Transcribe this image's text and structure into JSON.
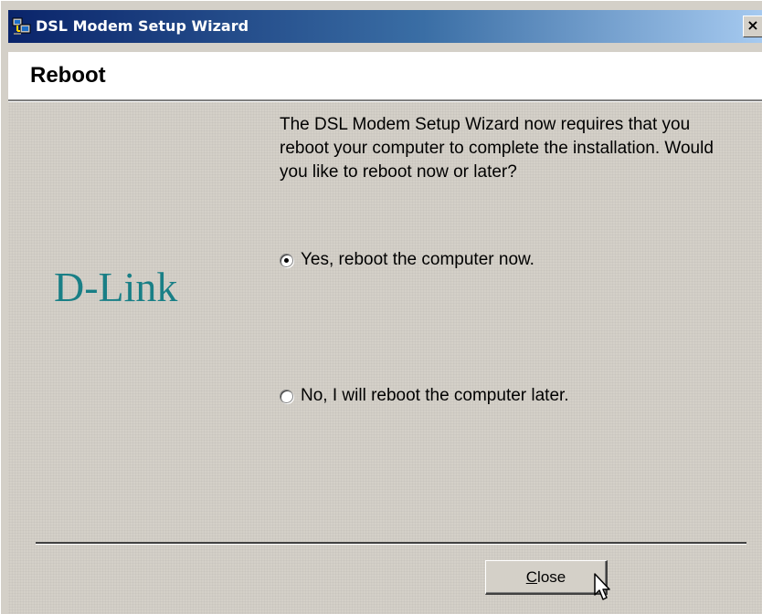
{
  "window": {
    "title": "DSL Modem Setup Wizard",
    "close_glyph": "×"
  },
  "header": {
    "title": "Reboot"
  },
  "brand": {
    "logo_text": "D-Link",
    "logo_color": "#197f86"
  },
  "body": {
    "message": "The DSL Modem Setup Wizard now requires that you reboot your computer to complete the installation.  Would you like to reboot now or later?"
  },
  "options": [
    {
      "label": "Yes, reboot the computer now.",
      "checked": true
    },
    {
      "label": "No, I will reboot the computer later.",
      "checked": false
    }
  ],
  "footer": {
    "close_button": {
      "mnemonic": "C",
      "rest": "lose"
    }
  },
  "icons": {
    "title_icon": "network-computer-icon",
    "cursor": "mouse-pointer-icon"
  }
}
